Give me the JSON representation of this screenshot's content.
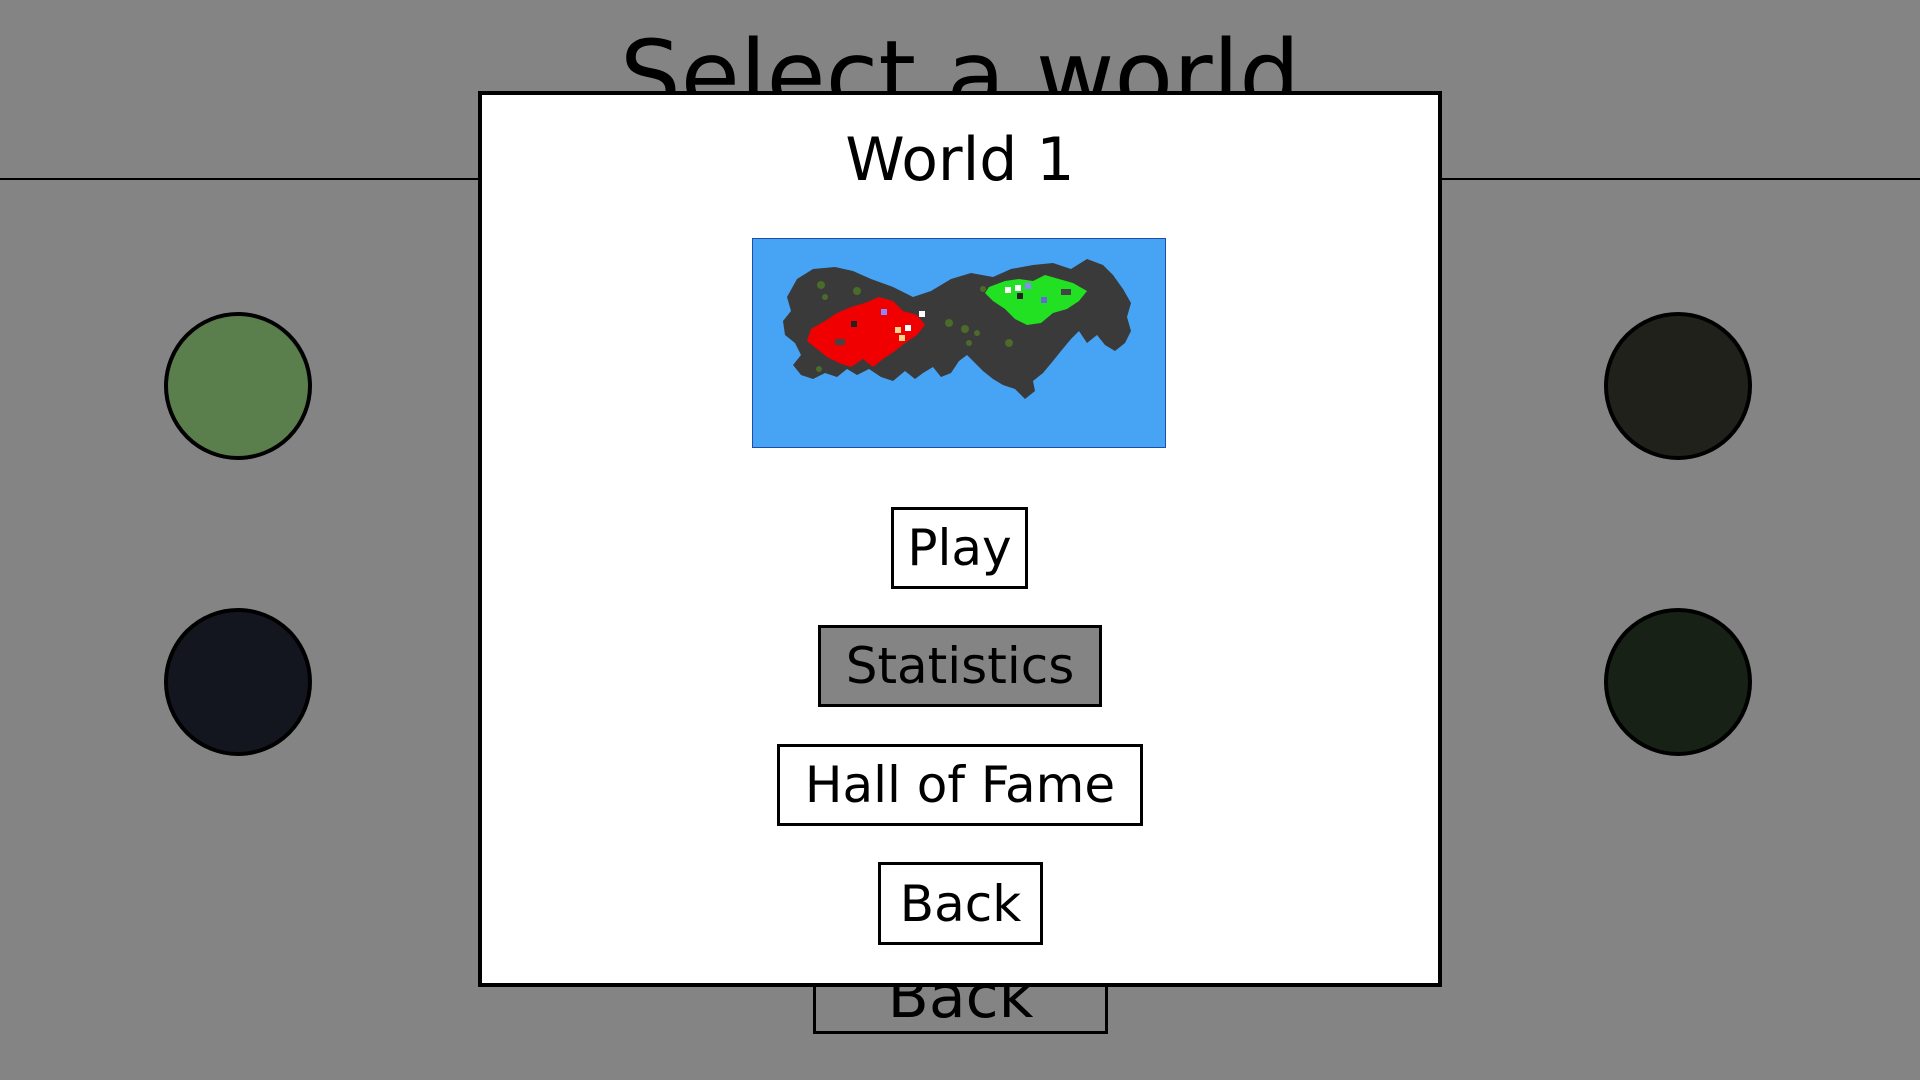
{
  "background": {
    "title": "Select a world",
    "back_label": "Back",
    "world_colors": [
      "#5b7e4d",
      "#14161f",
      "#20211a",
      "#172115"
    ]
  },
  "modal": {
    "title": "World 1",
    "buttons": {
      "play": "Play",
      "statistics": "Statistics",
      "hall_of_fame": "Hall of Fame",
      "back": "Back"
    },
    "highlighted_button": "statistics"
  },
  "map_colors": {
    "water": "#47a3f4",
    "land": "#3a3a3a",
    "player_red": "#f00000",
    "player_green": "#22e022",
    "tree": "#4b6b2a"
  }
}
